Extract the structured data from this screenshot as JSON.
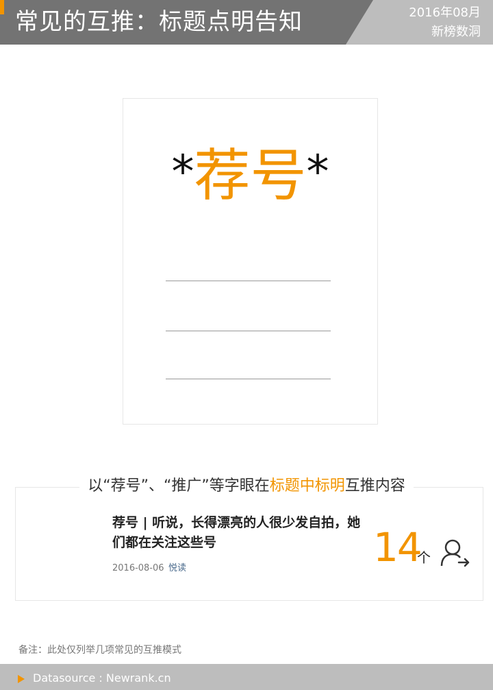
{
  "header": {
    "title": "常见的互推：标题点明告知",
    "date": "2016年08月",
    "brand": "新榜数洞"
  },
  "card": {
    "asterisk_left": "*",
    "keyword": "荐号",
    "asterisk_right": "*"
  },
  "caption": {
    "part1": "以“荐号”、“推广”等字眼在",
    "highlight": "标题中标明",
    "part2": "互推内容"
  },
  "article": {
    "title": "荐号 | 听说，长得漂亮的人很少发自拍，她们都在关注这些号",
    "date": "2016-08-06",
    "source": "悦读"
  },
  "count": {
    "value": "14",
    "unit": "个",
    "icon": "follow-user-icon"
  },
  "note": "备注：此处仅列举几项常见的互推模式",
  "footer": {
    "icon": "play-arrow-icon",
    "text": "Datasource : Newrank.cn"
  },
  "colors": {
    "accent": "#f29400",
    "header_dark": "#737373",
    "header_light": "#bdbdbd"
  }
}
